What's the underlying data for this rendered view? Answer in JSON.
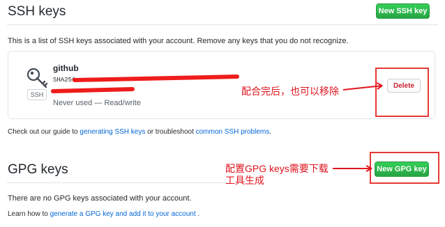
{
  "ssh": {
    "title": "SSH keys",
    "new_button": "New SSH key",
    "description": "This is a list of SSH keys associated with your account. Remove any keys that you do not recognize.",
    "key": {
      "name": "github",
      "fingerprint_prefix": "SHA256",
      "type_badge": "SSH",
      "usage": "Never used — Read/write",
      "delete_label": "Delete"
    },
    "guide": {
      "prefix": "Check out our guide to ",
      "link1": "generating SSH keys",
      "middle": " or troubleshoot ",
      "link2": "common SSH problems",
      "suffix": "."
    }
  },
  "gpg": {
    "title": "GPG keys",
    "new_button": "New GPG key",
    "empty_text": "There are no GPG keys associated with your account.",
    "learn": {
      "prefix": "Learn how to ",
      "link": "generate a GPG key and add it to your account",
      "suffix": " ."
    }
  },
  "annotations": {
    "delete_note": "配合完后，也可以移除",
    "gpg_note_line1": "配置GPG keys需要下载",
    "gpg_note_line2": "工具生成"
  },
  "colors": {
    "primary_button": "#2ea44f",
    "danger_text": "#cb2431",
    "link": "#0366d6",
    "annotation_red": "#e0141e"
  }
}
